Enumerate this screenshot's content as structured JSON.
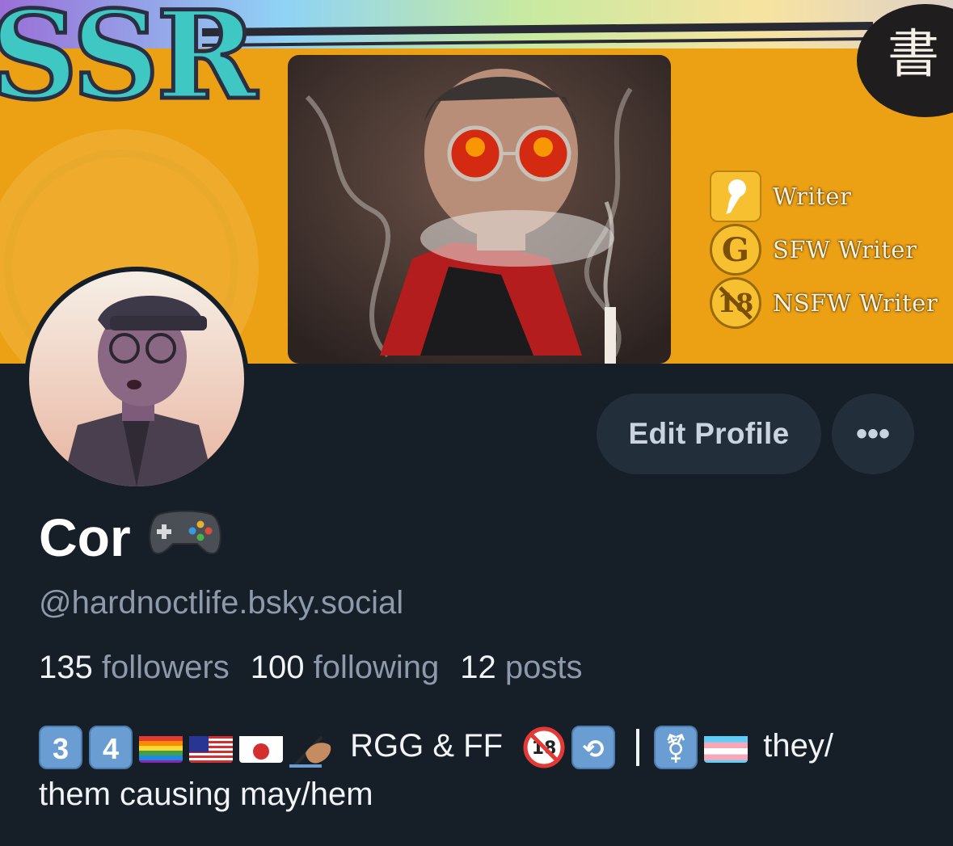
{
  "banner": {
    "title": "SSR",
    "kanji": "書",
    "badges": [
      {
        "icon": "writer-quill-icon",
        "label": "Writer"
      },
      {
        "icon": "g-rating-icon",
        "glyph": "G",
        "label": "SFW Writer"
      },
      {
        "icon": "no-18-icon",
        "glyph": "18",
        "label": "NSFW Writer"
      }
    ]
  },
  "actions": {
    "edit_profile": "Edit Profile",
    "more": "•••"
  },
  "profile": {
    "display_name": "Cor",
    "name_emoji": "video-game-controller-icon",
    "handle": "@hardnoctlife.bsky.social",
    "followers_count": "135",
    "followers_label": "followers",
    "following_count": "100",
    "following_label": "following",
    "posts_count": "12",
    "posts_label": "posts",
    "bio": {
      "keycap_1": "3",
      "keycap_2": "4",
      "text_1": "RGG & FF",
      "text_2": "they/",
      "line_2": "them causing may/hem"
    }
  },
  "colors": {
    "background": "#161e27",
    "button_bg": "#232e3b",
    "button_text": "#c9d4e0",
    "muted_text": "#8d9aab",
    "primary_text": "#f1f4f7",
    "banner_orange": "#f2a512"
  }
}
